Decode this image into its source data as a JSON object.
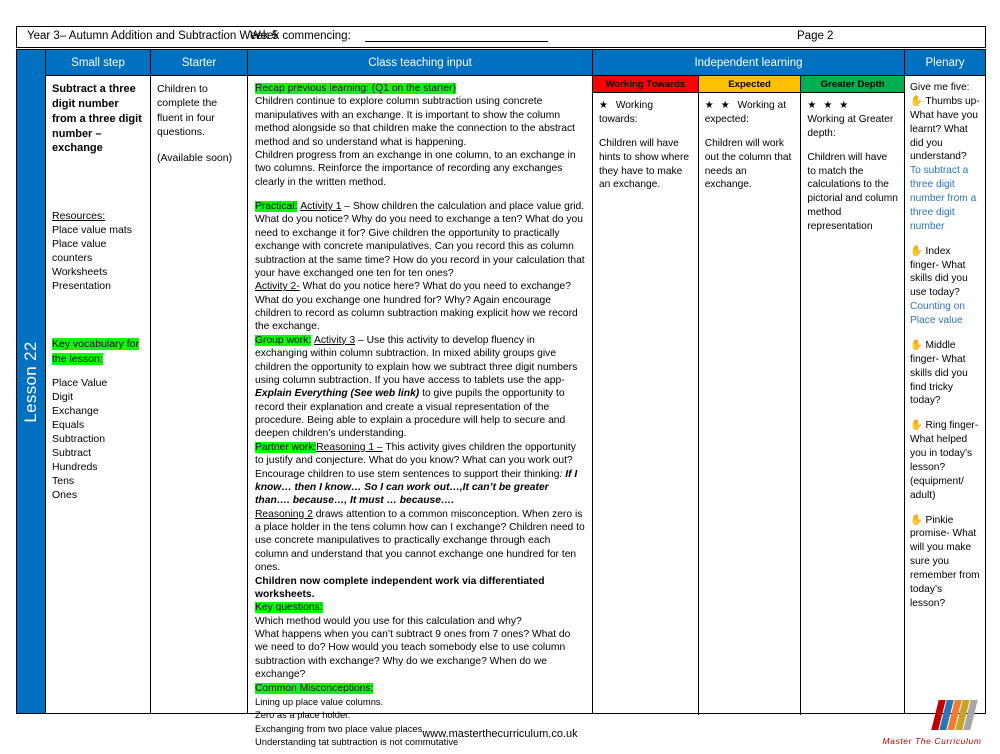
{
  "header": {
    "title": "Year 3– Autumn Addition and Subtraction Week 5",
    "week_commencing_label": "Week commencing:",
    "page_label": "Page 2"
  },
  "spine": {
    "lesson_label": "Lesson 22"
  },
  "columns": {
    "small_step": "Small step",
    "starter": "Starter",
    "class_teaching_input": "Class teaching input",
    "independent_learning": "Independent learning",
    "plenary": "Plenary"
  },
  "small_step": {
    "title": "Subtract a three digit number from a three digit number – exchange",
    "resources_label": "Resources:",
    "resources": [
      "Place value mats",
      "Place value counters",
      "Worksheets",
      "Presentation"
    ],
    "key_vocab_label": "Key vocabulary for the lesson:",
    "vocabulary": [
      "Place Value",
      "Digit",
      "Exchange",
      "Equals",
      "Subtraction",
      "Subtract",
      "Hundreds",
      "Tens",
      "Ones"
    ]
  },
  "starter": {
    "line1": "Children to complete the fluent in four questions.",
    "line2": "(Available soon)"
  },
  "class_teaching": {
    "recap_label": "Recap previous learning: (Q1 on the starter)",
    "recap_p1": "Children continue to explore column subtraction using concrete manipulatives with an exchange. It is important to show the column method alongside so that children make the connection to the abstract method and so understand what is happening.",
    "recap_p2": "Children progress from an exchange in one column, to an exchange in two columns. Reinforce the importance of recording any exchanges clearly in the written method.",
    "practical_label": "Practical:",
    "activity1_label": "Activity 1",
    "activity1_text": " – Show children the calculation and place value grid.  What do you notice?  Why do you need to exchange a ten? What do you need to exchange it for?  Give children the opportunity to practically exchange with concrete manipulatives.   Can you record this as column subtraction at the same time? How do you record in your calculation that your have exchanged one ten for ten ones?",
    "activity2_label": "Activity 2-",
    "activity2_text": " What do you notice here?  What do you need to exchange? What do you exchange one hundred for?  Why? Again encourage children to record as column subtraction making explicit how we record the exchange.",
    "groupwork_label": "Group work:",
    "activity3_label": "Activity 3",
    "activity3_text_a": " – Use this activity to develop fluency in exchanging within column subtraction.    In mixed ability groups give children  the opportunity to explain how we subtract three digit numbers using column subtraction.  If you have access to tablets use the app- ",
    "activity3_app": "Explain Everything  (See web link)",
    "activity3_text_b": " to give pupils the opportunity to record their explanation and create a  visual representation of the procedure.  Being able to explain a procedure will help to secure and deepen children’s understanding.",
    "partnerwork_label": "Partner work:",
    "reasoning1_label": "Reasoning 1 –",
    "reasoning1_text": " This activity gives children the opportunity to justify and conjecture.   What do you know?  What can you work out? Encourage children to use stem sentences to support their thinking",
    "stem_colon": ":  ",
    "stem_sentences": "If I know… then I know… So I can work out…,It can’t be greater than…. because…,  It must … because….",
    "reasoning2_label": "Reasoning 2",
    "reasoning2_text": " draws attention to a common misconception.  When zero is a place holder in the tens column how can I exchange?  Children need to use concrete manipulatives to practically exchange through each column and understand that you cannot exchange one hundred for ten ones.",
    "independent_note": "Children now complete independent work via differentiated worksheets.",
    "key_questions_label": "Key questions:",
    "key_questions": "Which method would you use for this calculation and why?\nWhat happens when you can’t subtract 9 ones from 7 ones? What do we need to do? How would you teach somebody else to use column subtraction with exchange? Why do we exchange? When do we exchange?",
    "misconceptions_label": "Common Misconceptions:",
    "misconceptions": [
      "Lining up place value columns.",
      "Zero as a place holder.",
      "Exchanging from two place value places.",
      "Understanding tat subtraction is not commutative"
    ]
  },
  "independent_learning": {
    "bands": [
      {
        "name": "Working Towards",
        "color": "#FF0000",
        "text_color": "#000000",
        "stars": "★",
        "heading": "Working towards:",
        "body": "Children will have hints to show where they have to make an exchange."
      },
      {
        "name": "Expected",
        "color": "#FFC000",
        "text_color": "#000000",
        "stars": "★ ★",
        "heading": "Working at expected:",
        "body": "Children will work out the column that needs an exchange."
      },
      {
        "name": "Greater Depth",
        "color": "#00B050",
        "text_color": "#000000",
        "stars": "★ ★ ★",
        "heading": "Working at Greater depth:",
        "body": "Children will have to match the calculations to the pictorial and column method representation"
      }
    ]
  },
  "plenary": {
    "intro": "Give me five:",
    "items": [
      {
        "icon": "hand-icon",
        "question": "Thumbs up- What have you learnt? What did you understand?",
        "answer": "To subtract a three digit number from a three digit number"
      },
      {
        "icon": "hand-icon",
        "question": "Index finger- What skills did you use today?",
        "answer": "Counting on Place value"
      },
      {
        "icon": "hand-icon",
        "question": "Middle finger- What skills did you find tricky today?",
        "answer": ""
      },
      {
        "icon": "hand-icon",
        "question": "Ring finger- What helped you in today’s lesson? (equipment/ adult)",
        "answer": ""
      },
      {
        "icon": "hand-icon",
        "question": "Pinkie promise- What will you make sure you remember from today’s lesson?",
        "answer": ""
      }
    ]
  },
  "footer": {
    "url": "www.masterthecurriculum.co.uk",
    "logo_caption": "Master  The  Curriculum",
    "logo_colors": [
      "#C00000",
      "#2E74B5",
      "#ED7D31",
      "#C9A227",
      "#A6A6A6"
    ]
  },
  "theme": {
    "header_blue": "#0070C0",
    "highlight_green": "#00FF00",
    "plenary_blue": "#2E74B5"
  }
}
